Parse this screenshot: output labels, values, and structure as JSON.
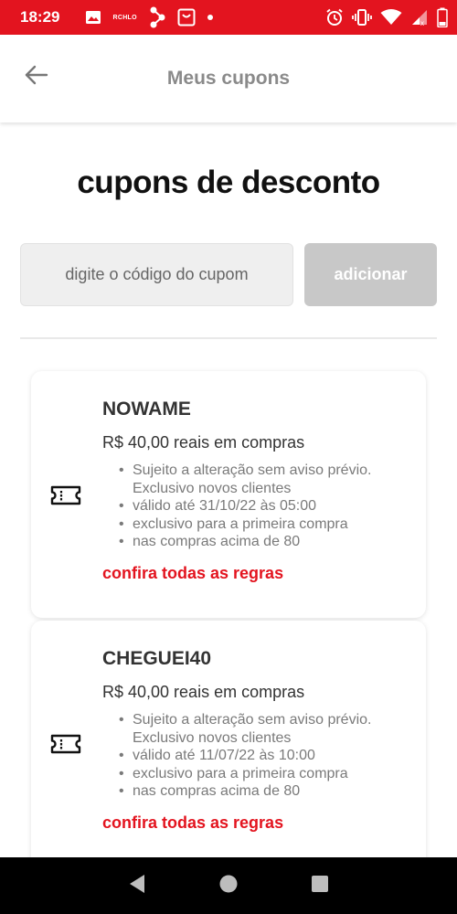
{
  "status_bar": {
    "time": "18:29",
    "rchlo": "RCHLO",
    "background_color": "#e3141f"
  },
  "app_bar": {
    "title": "Meus cupons",
    "back_icon": "arrow-left-icon"
  },
  "page": {
    "heading": "cupons de desconto"
  },
  "coupon_form": {
    "placeholder": "digite o código do cupom",
    "button_label": "adicionar"
  },
  "coupons": [
    {
      "code": "NOWAME",
      "amount": "R$ 40,00 reais em compras",
      "rules": [
        "Sujeito a alteração sem aviso prévio. Exclusivo novos clientes",
        "válido até 31/10/22 às 05:00",
        "exclusivo para a primeira compra",
        "nas compras acima de 80"
      ],
      "link_label": "confira todas as regras"
    },
    {
      "code": "CHEGUEI40",
      "amount": "R$ 40,00 reais em compras",
      "rules": [
        "Sujeito a alteração sem aviso prévio. Exclusivo novos clientes",
        "válido até 11/07/22 às 10:00",
        "exclusivo para a primeira compra",
        "nas compras acima de 80"
      ],
      "link_label": "confira todas as regras"
    }
  ],
  "colors": {
    "accent": "#e3141f",
    "disabled_button": "#c8c8c8"
  }
}
